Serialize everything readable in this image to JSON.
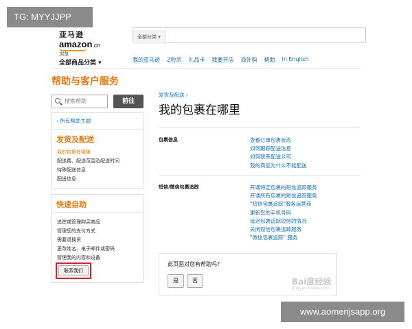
{
  "overlay_tag": "TG: MYYJJPP",
  "overlay_url": "www.aomenjsapp.org",
  "logo": {
    "cn": "亚马逊",
    "en": "amazon",
    "suffix": ".cn"
  },
  "search_category": "全部分类",
  "category_browse": {
    "small": "浏览",
    "main": "全部商品分类"
  },
  "topnav": [
    "我的亚马逊",
    "Z秒杀",
    "礼品卡",
    "我要开店",
    "海外购",
    "帮助",
    "In English"
  ],
  "help_title": "帮助与客户服务",
  "help_search": {
    "placeholder": "搜索帮助",
    "button": "前往"
  },
  "sidebar": {
    "back_link": "‹ 所有帮助主题",
    "section1_title": "发货及配送",
    "section1_items": [
      "我的包裹在哪里",
      "配送费、配送范围及配送时间",
      "特殊配送信息",
      "配送信息"
    ],
    "section2_title": "快速自助",
    "section2_items": [
      "追踪或管理购买商品",
      "管理您的支付方式",
      "需要退换货",
      "更改姓名、电子邮件或密码",
      "管理我的内容和设备"
    ],
    "contact_button": "联系我们"
  },
  "breadcrumb": "发货及配送 ›",
  "page_title": "我的包裹在哪里",
  "sections": [
    {
      "label": "包裹信息",
      "links": [
        "查看订单包裹状态",
        "如何跟踪配送信息",
        "如何联系配送公司",
        "我的商品为什么不能配送"
      ]
    },
    {
      "label": "短信/微信包裹追踪",
      "links": [
        "开通特定包裹的短信追踪服务",
        "开通所有包裹的短信追踪服务",
        "\"短信包裹追踪\"服务运营商",
        "更新您的手机号码",
        "延迟包裹追踪短信的情况",
        "关闭短信包裹追踪服务",
        "\"微信包裹追踪\" 服务"
      ]
    }
  ],
  "feedback": {
    "question": "此页面对您有帮助吗?",
    "yes": "是",
    "no": "否"
  },
  "watermark": {
    "main": "Bai度经验",
    "sub": "jingyan.baidu.com"
  }
}
